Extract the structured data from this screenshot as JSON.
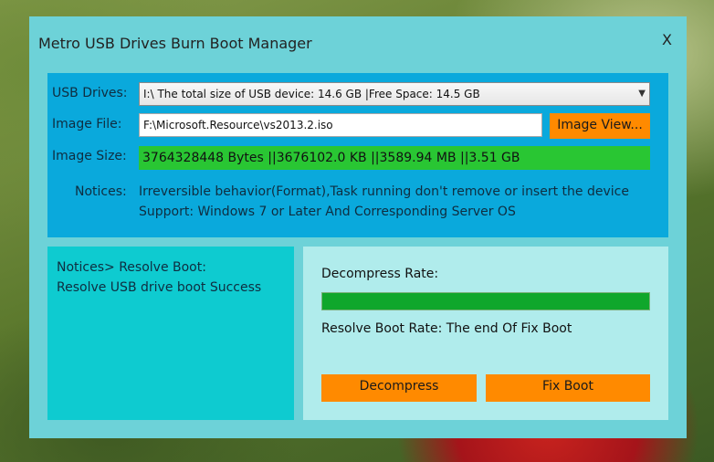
{
  "window": {
    "title": "Metro USB Drives Burn Boot Manager",
    "close_label": "X"
  },
  "top_panel": {
    "usb_label": "USB Drives:",
    "usb_value": "I:\\  The total size of USB device: 14.6 GB  |Free Space: 14.5 GB",
    "image_file_label": "Image File:",
    "image_file_value": "F:\\Microsoft.Resource\\vs2013.2.iso",
    "image_view_button": "Image View...",
    "image_size_label": "Image Size:",
    "image_size_value": "3764328448 Bytes ||3676102.0 KB ||3589.94 MB ||3.51 GB",
    "notices_label": "Notices:",
    "notices_line1": "Irreversible behavior(Format),Task running don't remove or insert the device",
    "notices_line2": "Support: Windows 7 or Later And Corresponding Server OS"
  },
  "left_panel": {
    "line1": "Notices> Resolve Boot:",
    "line2": "Resolve USB drive boot Success"
  },
  "right_panel": {
    "decompress_rate_label": "Decompress Rate:",
    "decompress_progress": 1.0,
    "resolve_boot_rate": "Resolve Boot Rate: The end Of Fix Boot",
    "decompress_button": "Decompress",
    "fix_boot_button": "Fix Boot"
  },
  "colors": {
    "window_bg": "#6dd2d8",
    "top_panel_bg": "#0aa9dc",
    "left_panel_bg": "#0ecbd0",
    "right_panel_bg": "#b0ecec",
    "accent_orange": "#ff8a00",
    "size_green": "#29c633",
    "progress_green": "#0fa72c"
  }
}
